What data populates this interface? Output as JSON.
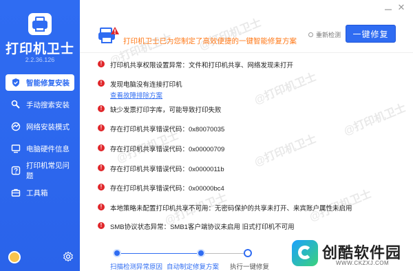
{
  "app": {
    "title": "打印机卫士",
    "version": "2.2.36.126"
  },
  "sidebar": {
    "items": [
      {
        "label": "智能修复安装",
        "icon": "shield-icon",
        "active": true
      },
      {
        "label": "手动搜索安装",
        "icon": "wrench-icon",
        "active": false
      },
      {
        "label": "网络安装模式",
        "icon": "network-icon",
        "active": false
      },
      {
        "label": "电脑硬件信息",
        "icon": "chip-icon",
        "active": false
      },
      {
        "label": "打印机常见问题",
        "icon": "question-icon",
        "active": false
      },
      {
        "label": "工具箱",
        "icon": "toolbox-icon",
        "active": false
      }
    ]
  },
  "header": {
    "message": "打印机卫士已为您制定了高效便捷的一键智能修复方案",
    "recheck_label": "重新检测",
    "fix_button": "一键修复"
  },
  "issues": [
    {
      "text": "打印机共享权限设置异常：文件和打印机共享、网络发现未打开"
    },
    {
      "text": "发现电脑没有连接打印机",
      "link": "查看故障排除方案"
    },
    {
      "text": "缺少发票打印字库，可能导致打印失败"
    },
    {
      "text": "存在打印机共享错误代码：0x80070035"
    },
    {
      "text": "存在打印机共享错误代码：0x00000709"
    },
    {
      "text": "存在打印机共享错误代码：0x0000011b"
    },
    {
      "text": "存在打印机共享错误代码：0x00000bc4"
    },
    {
      "text": "本地策略未配置打印机共享不可用：无密码保护的共享未打开、来宾账户属性未启用"
    },
    {
      "text": "SMB协议状态异常：SMB1客户端协议未启用 旧式打印机不可用"
    }
  ],
  "watermarks": [
    "@打印机卫士",
    "@打印机卫士",
    "@打印机卫士",
    "@打印机卫士",
    "@打印机卫士",
    "@打印机卫士",
    "@打印机卫士",
    "@打印机卫士"
  ],
  "steps": [
    {
      "label": "扫描检测异常原因",
      "state": "done"
    },
    {
      "label": "自动制定修复方案",
      "state": "done"
    },
    {
      "label": "执行一键修复",
      "state": "current"
    }
  ],
  "brand": {
    "name": "创酷软件园",
    "url": "WWW.CKZXJ.COM"
  },
  "colors": {
    "accent": "#2f6cf2",
    "warning": "#e0262a",
    "highlight": "#ff7a1a"
  }
}
